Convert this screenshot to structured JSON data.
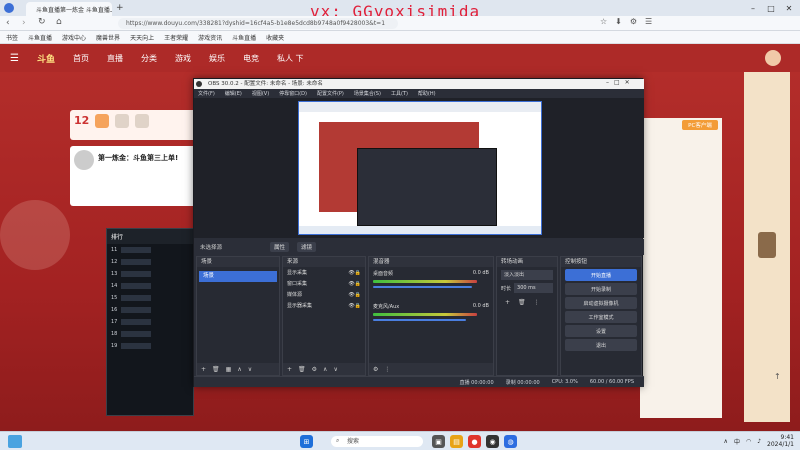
{
  "watermark": "vx: GGyoxisimida",
  "browser": {
    "tabs": [
      "斗鱼直播第一炼金 斗鱼直播上...",
      ""
    ],
    "url": "https://www.douyu.com/338281?dyshid=16cf4a5-b1e8e5dcd8b9748a0f9428003&t=1",
    "bookmarks": [
      "书签",
      "斗鱼直播",
      "游戏中心",
      "魔兽世界",
      "天天向上",
      "王者荣耀",
      "游戏资讯",
      "斗鱼直播",
      "收藏夹"
    ]
  },
  "douyu": {
    "logo": "斗鱼",
    "nav": [
      "首页",
      "直播",
      "分类",
      "游戏",
      "娱乐",
      "电竞",
      "私人 下"
    ],
    "room_count": "12",
    "room_title": "第一炼金：斗鱼第三上单!",
    "right_button": "PC客户端",
    "side_title": "排行",
    "ranks": [
      "11",
      "12",
      "13",
      "14",
      "15",
      "16",
      "17",
      "18",
      "19"
    ]
  },
  "obs": {
    "title": "OBS 30.0.2 - 配置文件: 未命名 - 场景: 未命名",
    "menu": [
      "文件(F)",
      "编辑(E)",
      "视图(V)",
      "停靠窗口(D)",
      "配置文件(P)",
      "场景集合(S)",
      "工具(T)",
      "帮助(H)"
    ],
    "scene_label": "未选择源",
    "buttons_top": [
      "属性",
      "滤镜"
    ],
    "scenes": {
      "title": "场景",
      "items": [
        "场景"
      ]
    },
    "sources": {
      "title": "来源",
      "items": [
        "显示采集",
        "窗口采集",
        "媒体源",
        "显示器采集"
      ]
    },
    "mixer": {
      "title": "混音器",
      "tracks": [
        {
          "name": "桌面音频",
          "db": "0.0 dB",
          "level": 0.85
        },
        {
          "name": "麦克风/Aux",
          "db": "0.0 dB",
          "level": 0.8
        }
      ]
    },
    "transitions": {
      "title": "转场动画",
      "type": "淡入淡出",
      "duration_label": "时长",
      "duration": "300 ms"
    },
    "controls": {
      "title": "控制按钮",
      "items": [
        "开始直播",
        "开始录制",
        "启动虚拟摄像机",
        "工作室模式",
        "设置",
        "退出"
      ]
    },
    "status": [
      "直播 00:00:00",
      "录制 00:00:00",
      "CPU: 3.0%",
      "60.00 / 60.00 FPS"
    ]
  },
  "taskbar": {
    "search_placeholder": "搜索",
    "time": "9:41",
    "date": "2024/1/1",
    "lang": "中"
  },
  "colors": {
    "accent": "#3c6fd6",
    "douyu_red": "#ad2a28",
    "obs_bg": "#2b2e38"
  }
}
